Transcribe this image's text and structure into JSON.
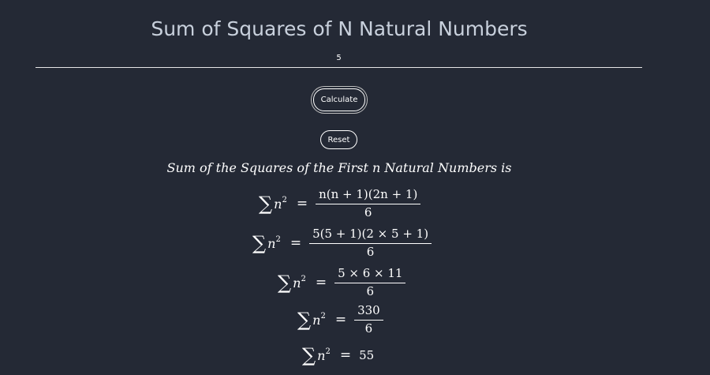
{
  "header": {
    "title": "Sum of Squares of N Natural Numbers"
  },
  "input": {
    "value": "5"
  },
  "buttons": {
    "calculate_label": "Calculate",
    "reset_label": "Reset"
  },
  "result": {
    "heading": "Sum of the Squares of the First n Natural Numbers is",
    "lhs": {
      "sigma": "∑",
      "variable": "n",
      "exponent": "2",
      "equals": "="
    },
    "steps": [
      {
        "numerator": "n(n + 1)(2n + 1)",
        "denominator": "6"
      },
      {
        "numerator": "5(5 + 1)(2 × 5 + 1)",
        "denominator": "6"
      },
      {
        "numerator": "5 × 6 × 11",
        "denominator": "6"
      },
      {
        "numerator": "330",
        "denominator": "6"
      }
    ],
    "final": "55"
  }
}
